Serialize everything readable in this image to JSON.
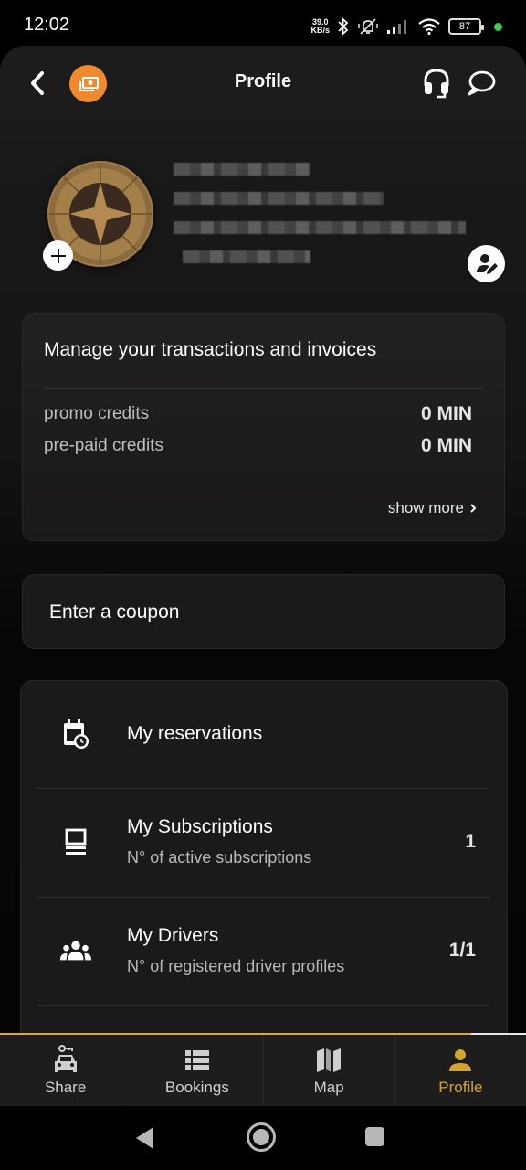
{
  "status_bar": {
    "time": "12:02",
    "net_speed_value": "39.0",
    "net_speed_unit": "KB/s",
    "battery": "87"
  },
  "header": {
    "title": "Profile"
  },
  "profile": {
    "name": "[blurred]",
    "details": [
      "[blurred]",
      "[blurred]",
      "[blurred]"
    ]
  },
  "credits": {
    "title": "Manage your transactions and invoices",
    "rows": [
      {
        "label": "promo credits",
        "value": "0 MIN"
      },
      {
        "label": "pre-paid credits",
        "value": "0 MIN"
      }
    ],
    "show_more": "show more"
  },
  "coupon": {
    "label": "Enter a coupon"
  },
  "menu": {
    "items": [
      {
        "title": "My reservations",
        "icon": "calendar-clock-icon"
      },
      {
        "title": "My Subscriptions",
        "subtitle": "N° of active subscriptions",
        "count": "1",
        "icon": "subscription-icon"
      },
      {
        "title": "My Drivers",
        "subtitle": "N° of registered driver profiles",
        "count": "1/1",
        "icon": "group-icon"
      }
    ]
  },
  "bottom_nav": {
    "items": [
      {
        "label": "Share",
        "icon": "car-key-icon",
        "active": false
      },
      {
        "label": "Bookings",
        "icon": "list-icon",
        "active": false
      },
      {
        "label": "Map",
        "icon": "map-icon",
        "active": false
      },
      {
        "label": "Profile",
        "icon": "person-icon",
        "active": true
      }
    ]
  },
  "colors": {
    "accent": "#d4a52e",
    "wallet_button": "#f08a2e",
    "background": "#141414",
    "card": "#1b1a1a"
  }
}
